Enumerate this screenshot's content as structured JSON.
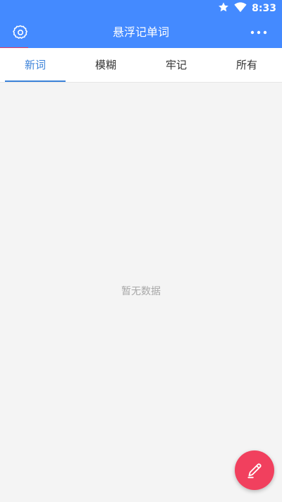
{
  "status_bar": {
    "time": "8:33",
    "icons": [
      "star-icon",
      "wifi-icon"
    ]
  },
  "toolbar": {
    "title": "悬浮记单词",
    "settings_icon": "gear-icon",
    "more_icon": "more-dots-icon"
  },
  "tabs": [
    {
      "label": "新词",
      "active": true
    },
    {
      "label": "模糊",
      "active": false
    },
    {
      "label": "牢记",
      "active": false
    },
    {
      "label": "所有",
      "active": false
    }
  ],
  "empty_state": {
    "text": "暂无数据"
  },
  "fab": {
    "icon": "pen-icon"
  },
  "colors": {
    "primary": "#448aff",
    "accent": "#f1405e",
    "tab_active": "#3b82d9",
    "background": "#f4f4f4"
  }
}
